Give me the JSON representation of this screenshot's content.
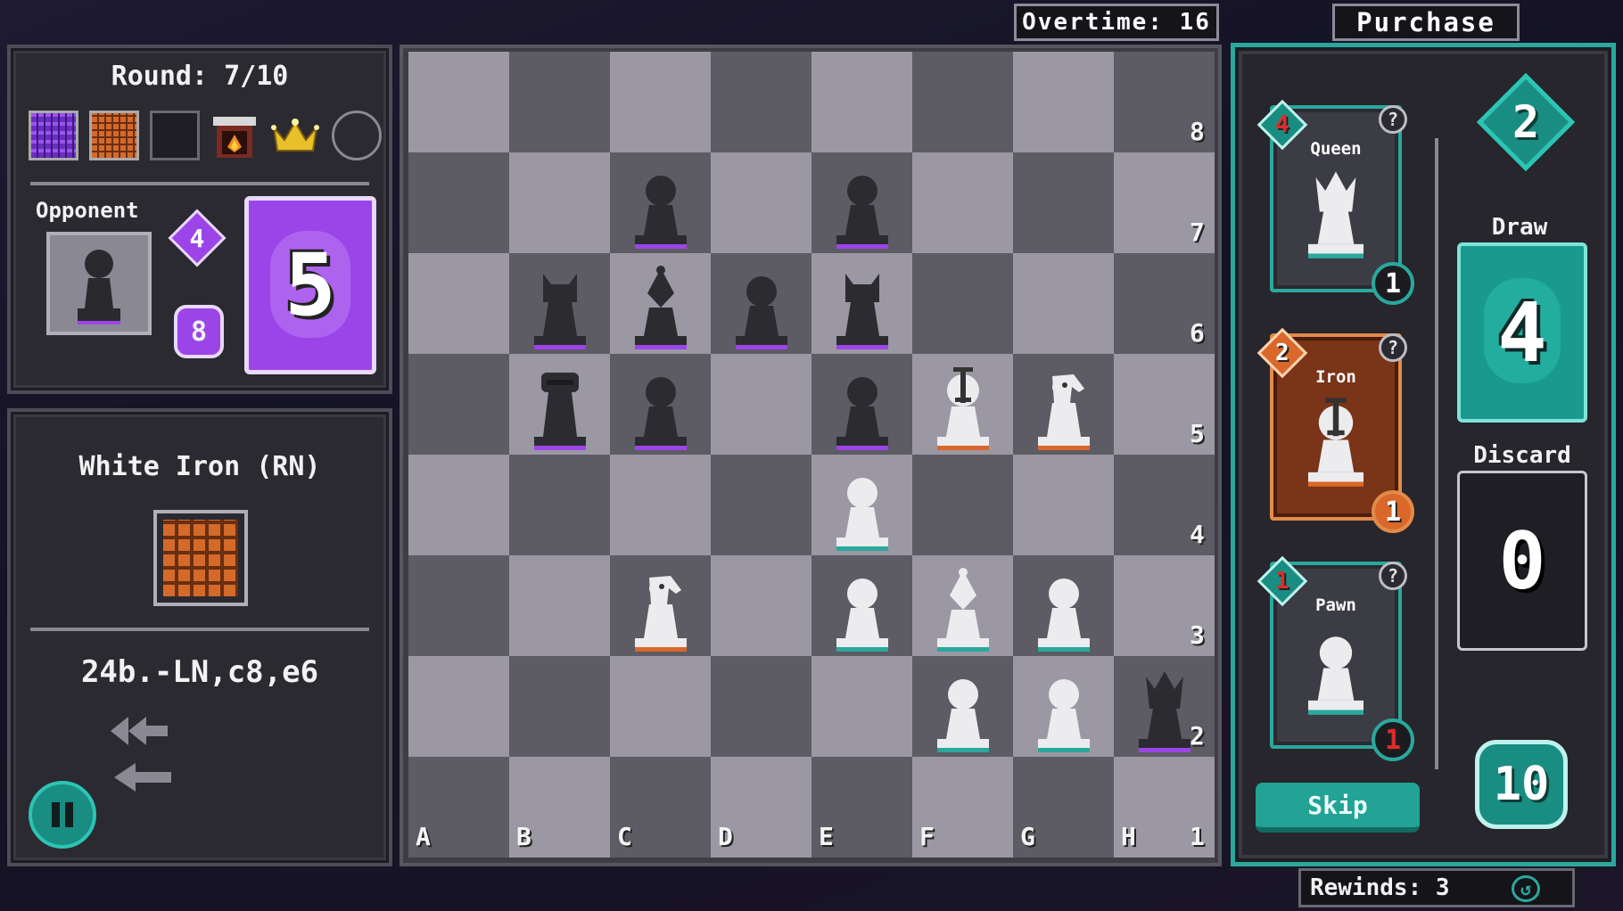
{
  "top": {
    "overtime": "Overtime: 16",
    "purchase": "Purchase",
    "rewinds": "Rewinds: 3"
  },
  "left_panel": {
    "round": "Round: 7/10",
    "modifiers": [
      "purple-grid-icon",
      "orange-grid-icon",
      "empty-slot",
      "fire-oven-icon",
      "crown-icon",
      "empty-circle"
    ],
    "opponent_label": "Opponent",
    "opponent_piece": "pawn",
    "opponent_cost": "4",
    "opponent_count": "8",
    "opponent_deck": "5",
    "selected_piece_name": "White Iron (RN)",
    "selected_icon": "orange-grid-icon",
    "move_notation": "24b.-LN,c8,e6"
  },
  "board": {
    "files": [
      "A",
      "B",
      "C",
      "D",
      "E",
      "F",
      "G",
      "H"
    ],
    "ranks": [
      "8",
      "7",
      "6",
      "5",
      "4",
      "3",
      "2",
      "1"
    ],
    "pieces": [
      {
        "square": "c7",
        "type": "pawn",
        "color": "black"
      },
      {
        "square": "e7",
        "type": "pawn",
        "color": "black"
      },
      {
        "square": "b6",
        "type": "cat",
        "color": "black"
      },
      {
        "square": "c6",
        "type": "bishop",
        "color": "black"
      },
      {
        "square": "d6",
        "type": "pawn",
        "color": "black"
      },
      {
        "square": "e6",
        "type": "cat",
        "color": "black"
      },
      {
        "square": "b5",
        "type": "rook",
        "color": "black"
      },
      {
        "square": "c5",
        "type": "pawn",
        "color": "black"
      },
      {
        "square": "e5",
        "type": "pawn",
        "color": "black"
      },
      {
        "square": "f5",
        "type": "iron",
        "color": "white"
      },
      {
        "square": "g5",
        "type": "knight",
        "color": "white"
      },
      {
        "square": "e4",
        "type": "pawn",
        "color": "white"
      },
      {
        "square": "c3",
        "type": "knight",
        "color": "white"
      },
      {
        "square": "e3",
        "type": "pawn",
        "color": "white"
      },
      {
        "square": "f3",
        "type": "bishop",
        "color": "white"
      },
      {
        "square": "g3",
        "type": "pawn",
        "color": "white"
      },
      {
        "square": "f2",
        "type": "pawn",
        "color": "white"
      },
      {
        "square": "g2",
        "type": "pawn",
        "color": "white"
      },
      {
        "square": "h2",
        "type": "queen",
        "color": "black"
      }
    ]
  },
  "shop": {
    "cards": [
      {
        "name": "Queen",
        "cost": "4",
        "count": "1",
        "piece": "queen",
        "style": "teal"
      },
      {
        "name": "Iron",
        "cost": "2",
        "count": "1",
        "piece": "iron",
        "style": "orange"
      },
      {
        "name": "Pawn",
        "cost": "1",
        "count": "1",
        "piece": "pawn",
        "style": "teal"
      }
    ],
    "skip_label": "Skip",
    "currency": "2",
    "draw_label": "Draw",
    "draw_count": "4",
    "discard_label": "Discard",
    "discard_count": "0",
    "deck_total": "10"
  },
  "colors": {
    "teal": "#2aa89c",
    "purple": "#9b45e8",
    "orange": "#d9682a"
  }
}
